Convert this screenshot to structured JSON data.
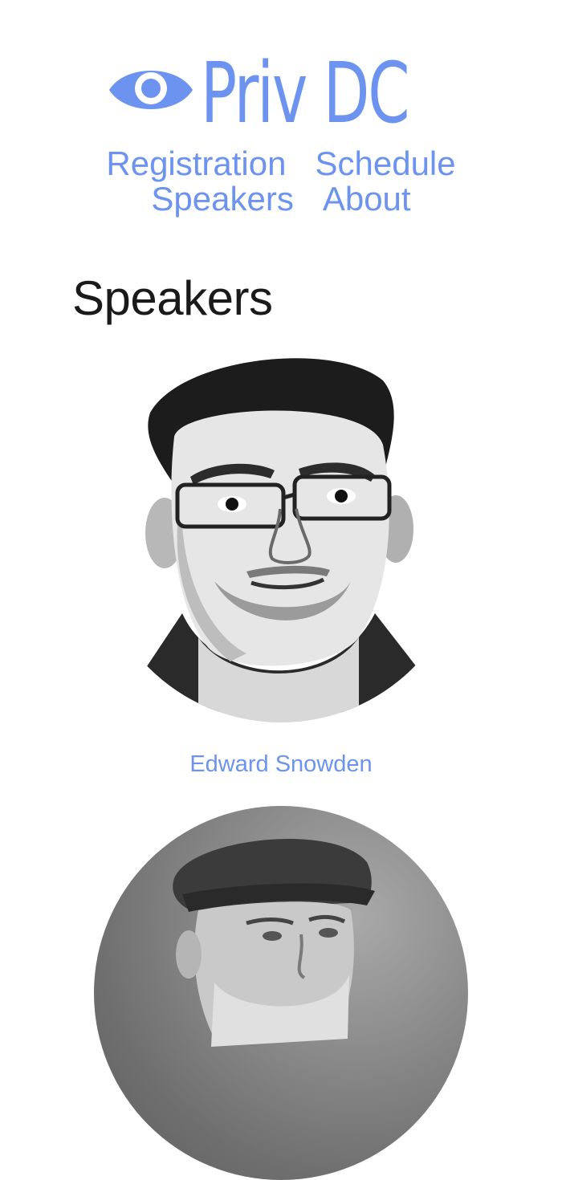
{
  "site": {
    "logo_text": "Priv DC",
    "logo_icon": "eye-icon",
    "brand_color": "#6b93ef"
  },
  "nav": {
    "registration": "Registration",
    "schedule": "Schedule",
    "speakers": "Speakers",
    "about": "About"
  },
  "page": {
    "title": "Speakers"
  },
  "speakers": [
    {
      "name": "Edward Snowden",
      "photo": "speaker-photo-edward-snowden"
    },
    {
      "name": "",
      "photo": "speaker-photo-2"
    }
  ]
}
